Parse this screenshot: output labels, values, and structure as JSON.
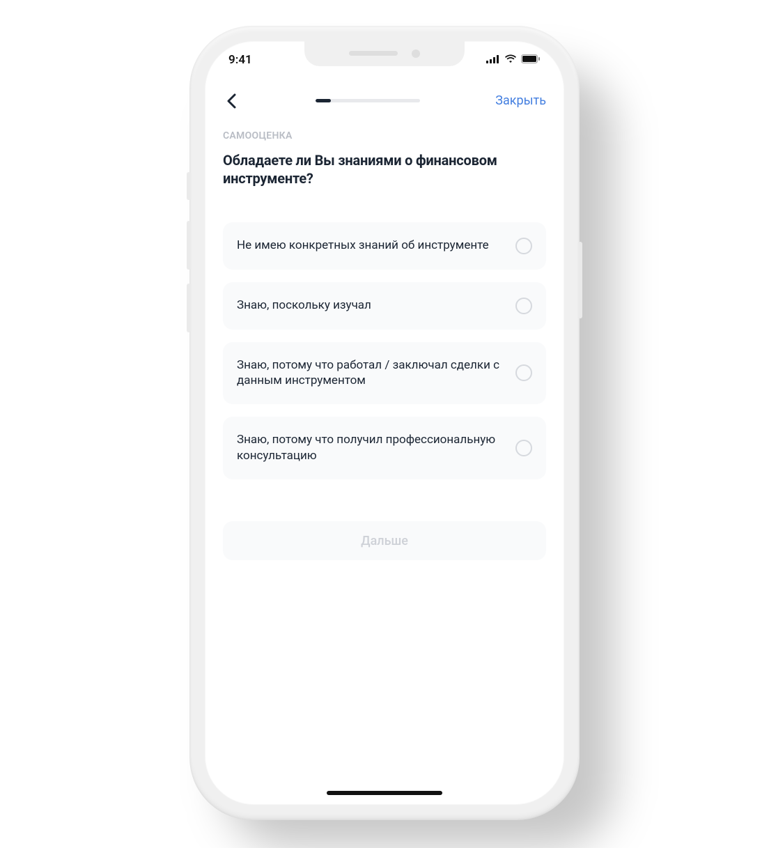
{
  "status": {
    "time": "9:41"
  },
  "nav": {
    "close_label": "Закрыть"
  },
  "section": {
    "label": "САМООЦЕНКА"
  },
  "question": "Обладаете ли Вы знаниями о финансовом инструменте?",
  "options": [
    {
      "text": "Не имею конкретных знаний об инструменте"
    },
    {
      "text": "Знаю, поскольку изучал"
    },
    {
      "text": "Знаю, потому что работал / заключал сделки с данным инструментом"
    },
    {
      "text": "Знаю, потому что получил профессиональную консультацию"
    }
  ],
  "next_label": "Дальше",
  "progress": {
    "percent": 15
  }
}
